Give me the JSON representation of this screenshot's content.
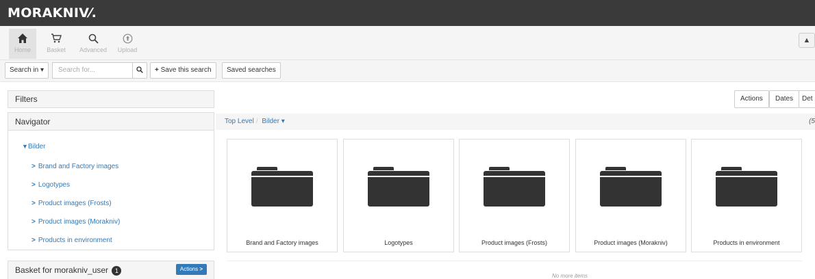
{
  "brand": {
    "logo_text": "MORAKNIV"
  },
  "nav": {
    "items": [
      {
        "label": "Home",
        "icon": "home-icon",
        "active": true
      },
      {
        "label": "Basket",
        "icon": "basket-icon"
      },
      {
        "label": "Advanced",
        "icon": "search-icon"
      },
      {
        "label": "Upload",
        "icon": "upload-icon"
      }
    ],
    "user_icon": "user-icon"
  },
  "search": {
    "search_in_label": "Search in ▾",
    "placeholder": "Search for...",
    "save_label": "Save this search",
    "saved_label": "Saved searches"
  },
  "sidebar": {
    "filters_title": "Filters",
    "navigator_title": "Navigator",
    "root_label": "Bilder",
    "items": [
      {
        "label": "Brand and Factory images"
      },
      {
        "label": "Logotypes"
      },
      {
        "label": "Product images (Frosts)"
      },
      {
        "label": "Product images (Morakniv)"
      },
      {
        "label": "Products in environment"
      }
    ],
    "basket_title": "Basket for morakniv_user",
    "basket_count": "1",
    "basket_actions": "Actions"
  },
  "toolbar": {
    "actions": "Actions",
    "dates": "Dates",
    "details": "Det"
  },
  "breadcrumb": {
    "top": "Top Level",
    "current": "Bilder ▾",
    "count": "(5"
  },
  "folders": [
    {
      "label": "Brand and Factory images"
    },
    {
      "label": "Logotypes"
    },
    {
      "label": "Product images (Frosts)"
    },
    {
      "label": "Product images (Morakniv)"
    },
    {
      "label": "Products in environment"
    }
  ],
  "footer": {
    "no_more": "No more items"
  }
}
